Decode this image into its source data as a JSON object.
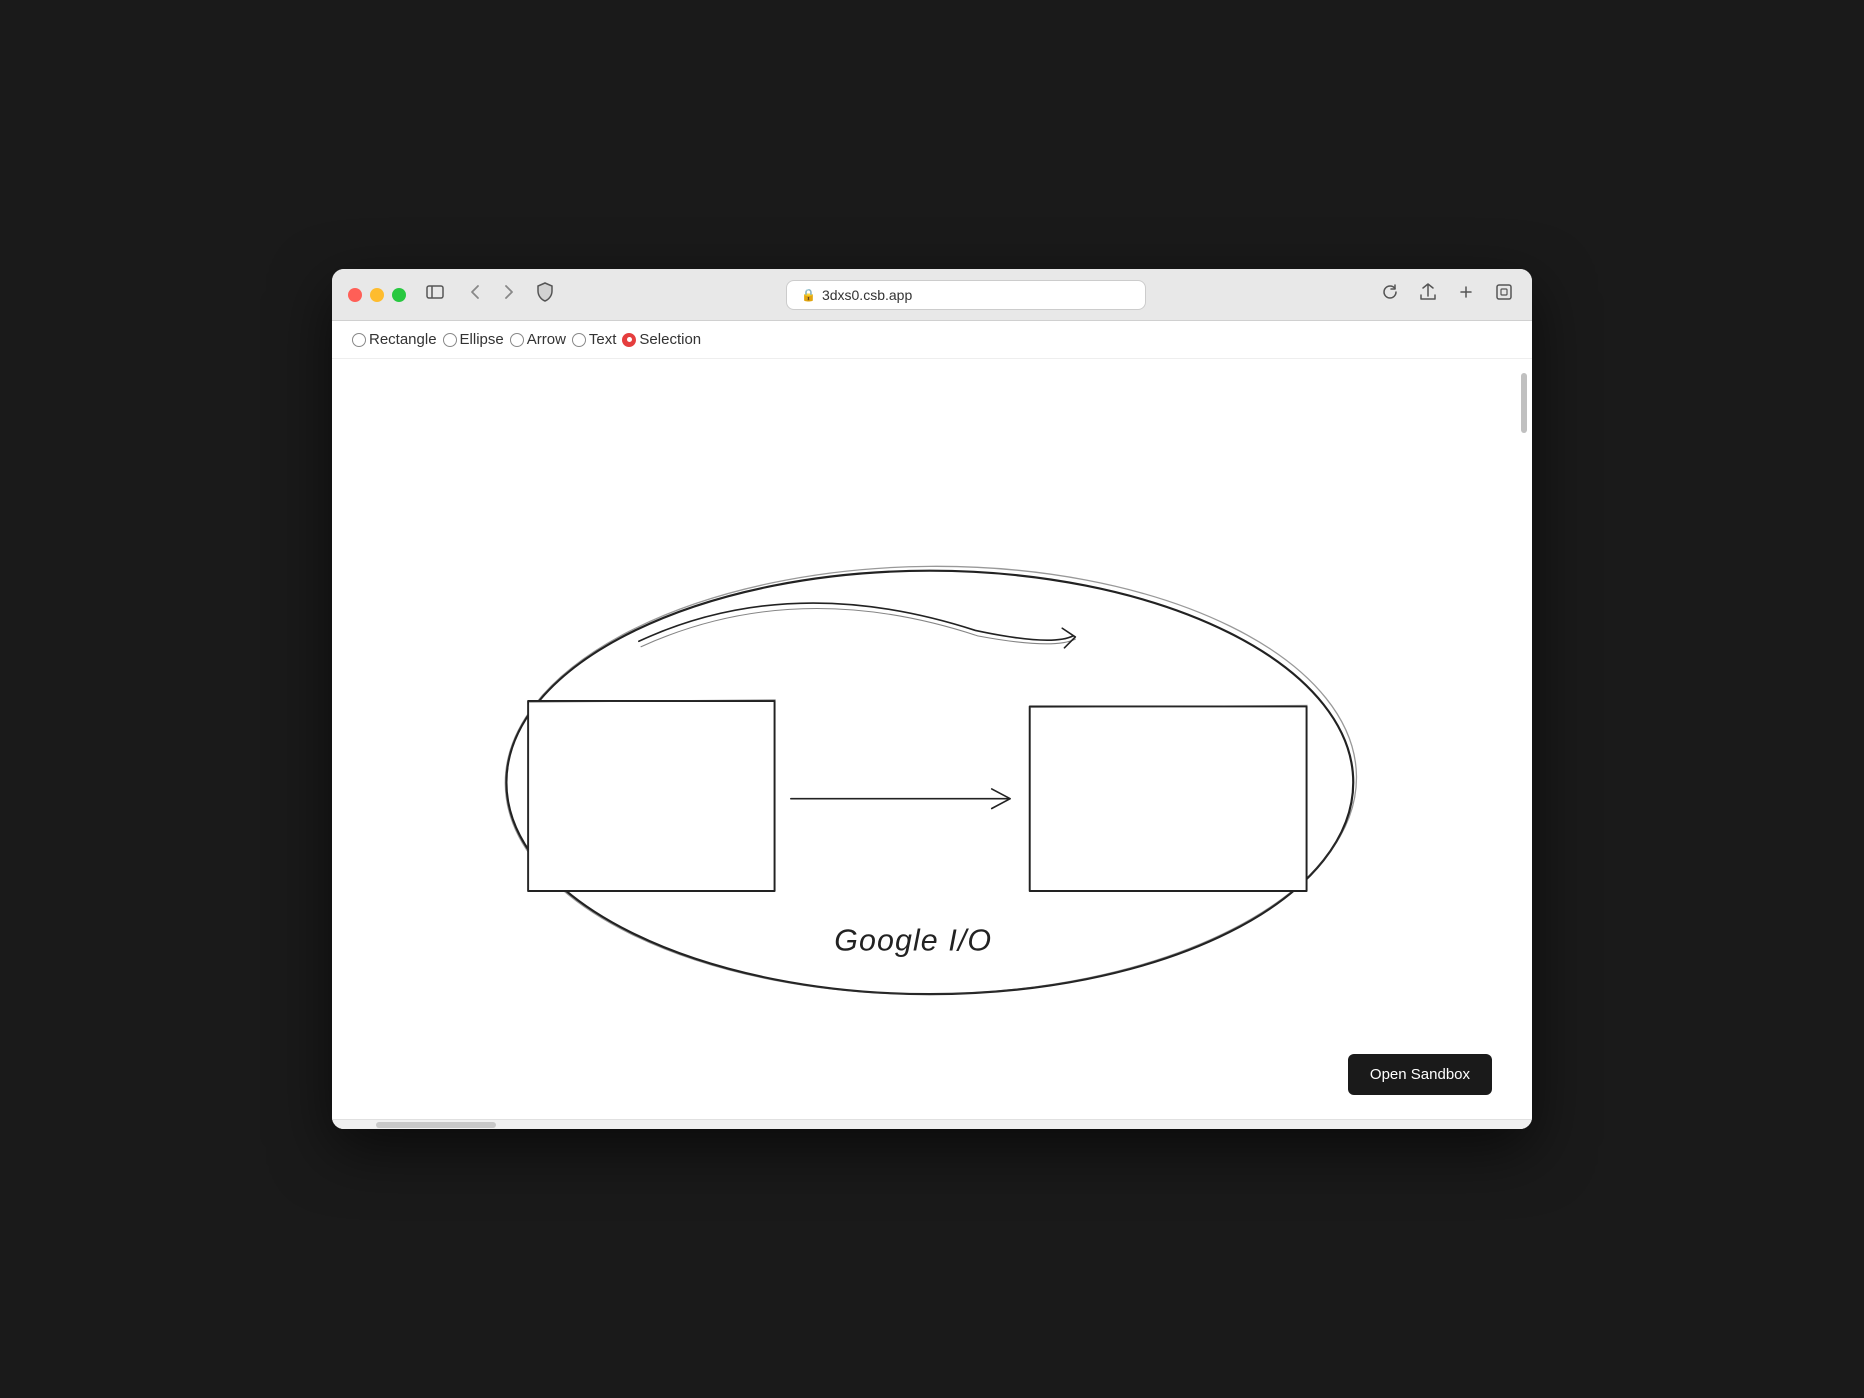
{
  "browser": {
    "url": "3dxs0.csb.app",
    "tab_title": "3dxs0.csb.app"
  },
  "toolbar": {
    "tools": [
      {
        "id": "rectangle",
        "label": "Rectangle",
        "selected": false
      },
      {
        "id": "ellipse",
        "label": "Ellipse",
        "selected": false
      },
      {
        "id": "arrow",
        "label": "Arrow",
        "selected": false
      },
      {
        "id": "text",
        "label": "Text",
        "selected": false
      },
      {
        "id": "selection",
        "label": "Selection",
        "selected": true
      }
    ]
  },
  "canvas": {
    "google_io_label": "Google I/O"
  },
  "open_sandbox_label": "Open Sandbox",
  "traffic_lights": {
    "close": "close",
    "minimize": "minimize",
    "maximize": "maximize"
  },
  "nav": {
    "back": "‹",
    "forward": "›"
  }
}
